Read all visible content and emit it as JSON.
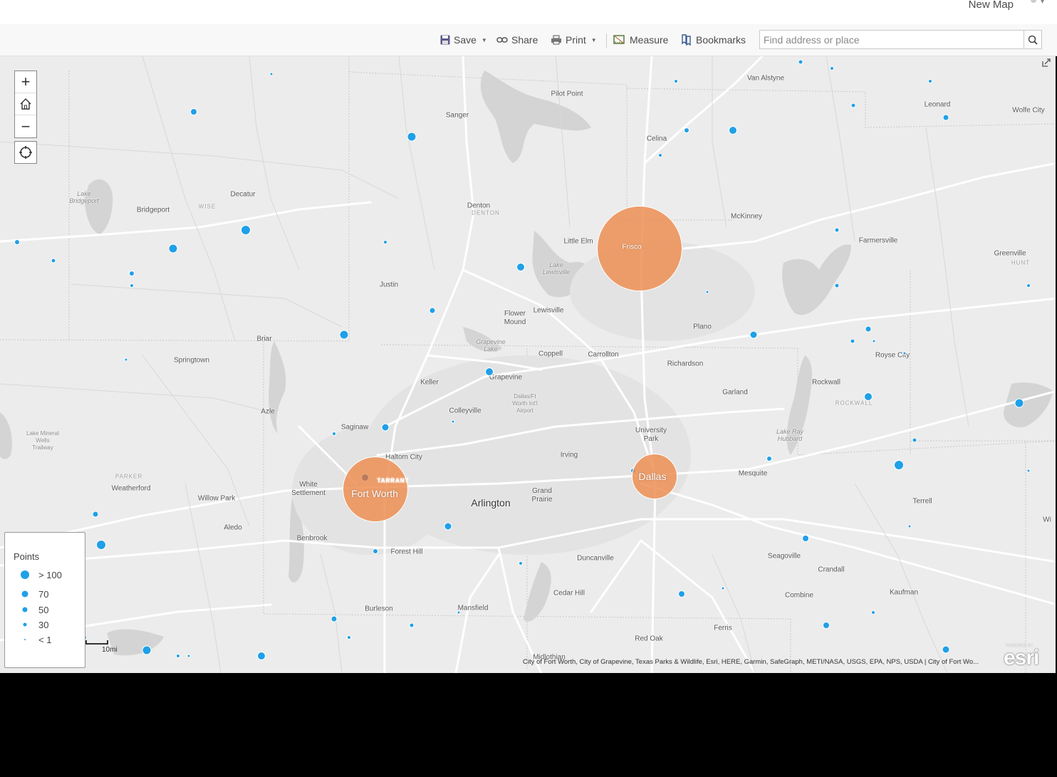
{
  "header": {
    "title": "New Map",
    "user_icon": "user-avatar-icon"
  },
  "toolbar": {
    "save": "Save",
    "share": "Share",
    "print": "Print",
    "measure": "Measure",
    "bookmarks": "Bookmarks",
    "search_placeholder": "Find address or place",
    "icons": {
      "save": "floppy-disk-icon",
      "share": "link-icon",
      "print": "printer-icon",
      "measure": "ruler-icon",
      "bookmarks": "bookmarks-icon",
      "search": "search-icon"
    }
  },
  "map_controls": {
    "zoom_in": "+",
    "zoom_out": "−",
    "home": "home-icon",
    "locate": "locate-icon",
    "expand": "expand-icon"
  },
  "places": [
    "Van Alstyne",
    "Pilot Point",
    "Leonard",
    "Wolfe City",
    "Sanger",
    "Celina",
    "Lake Bridgeport",
    "Decatur",
    "Bridgeport",
    "WISE",
    "Denton",
    "DENTON",
    "McKinney",
    "Little Elm",
    "Farmersville",
    "Lake Lewisville",
    "Greenville",
    "HUNT",
    "Justin",
    "Flower Mound",
    "Lewisville",
    "Plano",
    "Briar",
    "Grapevine Lake",
    "Coppell",
    "Carrollton",
    "Richardson",
    "Royse City",
    "Springtown",
    "Keller",
    "Grapevine",
    "Rockwall",
    "ROCKWALL",
    "Dallas/Ft Worth Int'l Airport",
    "Garland",
    "Azle",
    "Colleyville",
    "Lake Mineral Wells Trailway",
    "Saginaw",
    "University Park",
    "Lake Ray Hubbard",
    "Haltom City",
    "Irving",
    "Mesquite",
    "PARKER",
    "TARRANT",
    "Weatherford",
    "White Settlement",
    "Arlington",
    "Grand Prairie",
    "Willow Park",
    "Terrell",
    "Aledo",
    "Benbrook",
    "Forest Hill",
    "Duncanville",
    "Seagoville",
    "Crandall",
    "Cedar Hill",
    "Combine",
    "Kaufman",
    "Burleson",
    "Mansfield",
    "Ferris",
    "Red Oak",
    "Midlothian",
    "Wi"
  ],
  "clusters": [
    {
      "label": "Frisco",
      "count_class": "> 100"
    },
    {
      "label": "Fort Worth",
      "count_class": "> 100"
    },
    {
      "label": "Dallas",
      "count_class": "> 100"
    }
  ],
  "legend": {
    "title": "Points",
    "items": [
      {
        "label": "> 100",
        "value": 100
      },
      {
        "label": "70",
        "value": 70
      },
      {
        "label": "50",
        "value": 50
      },
      {
        "label": "30",
        "value": 30
      },
      {
        "label": "< 1",
        "value": 1
      }
    ],
    "point_color": "#1fa0e8",
    "cluster_color": "#ed8f54"
  },
  "scale": {
    "label": "10mi"
  },
  "attribution": "City of Fort Worth, City of Grapevine, Texas Parks & Wildlife, Esri, HERE, Garmin, SafeGraph, METI/NASA, USGS, EPA, NPS, USDA | City of Fort Wo...",
  "esri_logo": {
    "powered": "POWERED BY",
    "word": "esri"
  }
}
